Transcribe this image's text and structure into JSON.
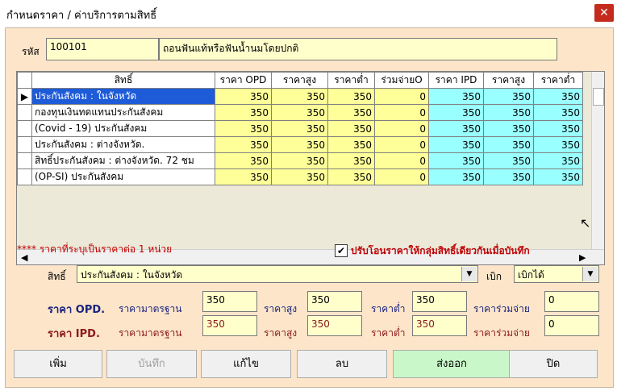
{
  "window": {
    "title": "กำหนดราคา / ค่าบริการตามสิทธิ์",
    "close": "✕"
  },
  "header": {
    "code_label": "รหัส",
    "code_value": "100101",
    "name_value": "ถอนฟันแท้หรือฟันน้ำนมโดยปกติ"
  },
  "grid": {
    "columns": [
      "สิทธิ์",
      "ราคา OPD",
      "ราคาสูง",
      "ราคาต่ำ",
      "ร่วมจ่ายO",
      "ราคา IPD",
      "ราคาสูง",
      "ราคาต่ำ"
    ],
    "rows": [
      {
        "marker": "▶",
        "name": "ประกันสังคม : ในจังหวัด",
        "v": [
          "350",
          "350",
          "350",
          "0",
          "350",
          "350",
          "350"
        ]
      },
      {
        "marker": "",
        "name": "กองทุนเงินทดแทนประกันสังคม",
        "v": [
          "350",
          "350",
          "350",
          "0",
          "350",
          "350",
          "350"
        ]
      },
      {
        "marker": "",
        "name": "(Covid - 19) ประกันสังคม",
        "v": [
          "350",
          "350",
          "350",
          "0",
          "350",
          "350",
          "350"
        ]
      },
      {
        "marker": "",
        "name": "ประกันสังคม : ต่างจังหวัด.",
        "v": [
          "350",
          "350",
          "350",
          "0",
          "350",
          "350",
          "350"
        ]
      },
      {
        "marker": "",
        "name": "สิทธิ์ประกันสังคม : ต่างจังหวัด. 72 ชม",
        "v": [
          "350",
          "350",
          "350",
          "0",
          "350",
          "350",
          "350"
        ]
      },
      {
        "marker": "",
        "name": "(OP-SI) ประกันสังคม",
        "v": [
          "350",
          "350",
          "350",
          "0",
          "350",
          "350",
          "350"
        ]
      }
    ]
  },
  "note": "**** ราคาที่ระบุเป็นราคาต่อ 1 หน่วย",
  "checkbox": {
    "checked": "✔",
    "label": "ปรับโอนราคาให้กลุ่มสิทธิ์เดียวกันเมื่อบันทึก"
  },
  "rights": {
    "label": "สิทธิ์",
    "value": "ประกันสังคม : ในจังหวัด",
    "claim_label": "เบิก",
    "claim_value": "เบิกได้"
  },
  "opd": {
    "label": "ราคา OPD.",
    "std_label": "ราคามาตรฐาน",
    "std": "350",
    "high_label": "ราคาสูง",
    "high": "350",
    "low_label": "ราคาต่ำ",
    "low": "350",
    "co_label": "ราคาร่วมจ่าย",
    "co": "0"
  },
  "ipd": {
    "label": "ราคา IPD.",
    "std_label": "ราคามาตรฐาน",
    "std": "350",
    "high_label": "ราคาสูง",
    "high": "350",
    "low_label": "ราคาต่ำ",
    "low": "350",
    "co_label": "ราคาร่วมจ่าย",
    "co": "0"
  },
  "buttons": {
    "add": "เพิ่ม",
    "save": "บันทึก",
    "edit": "แก้ไข",
    "delete": "ลบ",
    "export": "ส่งออก",
    "close": "ปิด"
  },
  "colors": {
    "opd_label": "#1a237e",
    "ipd_label": "#8b1a1a",
    "selected_row": "#1e5bd8",
    "yellow_cell": "#ffff99",
    "cyan_cell": "#99ffff",
    "background": "#fce5c9"
  }
}
